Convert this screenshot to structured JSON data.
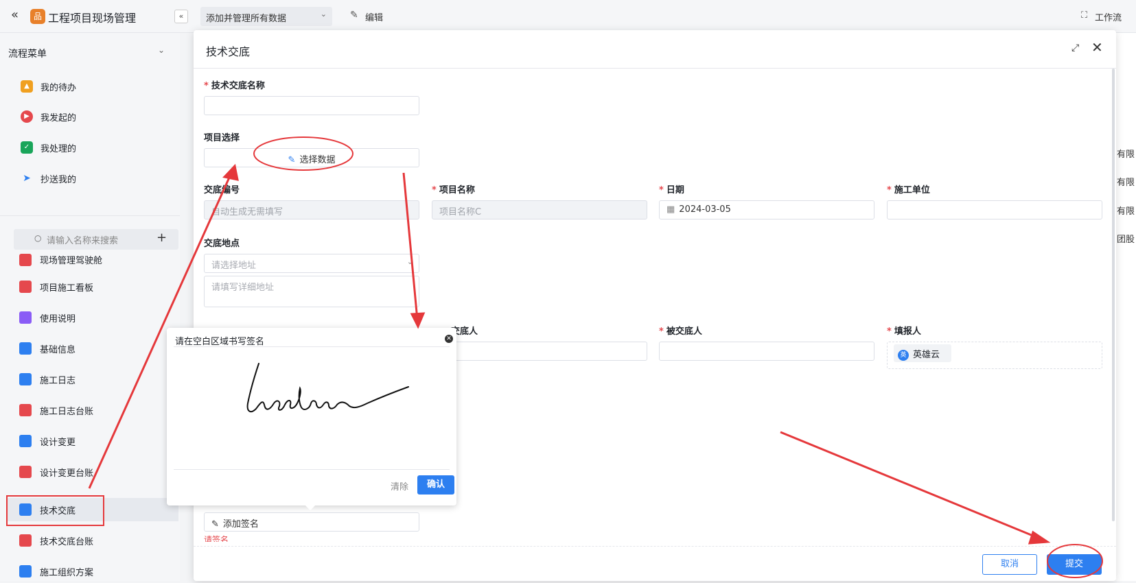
{
  "header": {
    "logo_char": "品",
    "app_title": "工程项目现场管理",
    "back_icon": "«",
    "collapse_icon": "«",
    "dataset_selector": "添加并管理所有数据",
    "edit_label": "编辑",
    "workflow_label": "工作流"
  },
  "sidebar": {
    "section_title": "流程菜单",
    "flow_items": [
      {
        "label": "我的待办",
        "icon": "bell-icon",
        "color": "#f0a020"
      },
      {
        "label": "我发起的",
        "icon": "play-icon",
        "color": "#e5484d"
      },
      {
        "label": "我处理的",
        "icon": "check-icon",
        "color": "#19a55a"
      },
      {
        "label": "抄送我的",
        "icon": "send-icon",
        "color": "#2d7ff0"
      }
    ],
    "search_placeholder": "请输入名称来搜索",
    "add_icon": "+",
    "nav_items": [
      {
        "label": "现场管理驾驶舱",
        "color": "#e5484d"
      },
      {
        "label": "项目施工看板",
        "color": "#e5484d"
      },
      {
        "label": "使用说明",
        "color": "#8a5cf6"
      },
      {
        "label": "基础信息",
        "color": "#2d7ff0"
      },
      {
        "label": "施工日志",
        "color": "#2d7ff0"
      },
      {
        "label": "施工日志台账",
        "color": "#e5484d"
      },
      {
        "label": "设计变更",
        "color": "#2d7ff0"
      },
      {
        "label": "设计变更台账",
        "color": "#e5484d"
      },
      {
        "label": "技术交底",
        "color": "#2d7ff0"
      },
      {
        "label": "技术交底台账",
        "color": "#e5484d"
      },
      {
        "label": "施工组织方案",
        "color": "#2d7ff0"
      }
    ]
  },
  "background_table": {
    "cells": [
      "有限",
      "有限",
      "有限",
      "团股"
    ]
  },
  "modal": {
    "title": "技术交底",
    "fields": {
      "name_label": "技术交底名称",
      "project_select_label": "项目选择",
      "select_data_button": "选择数据",
      "number_label": "交底编号",
      "number_placeholder": "自动生成无需填写",
      "project_name_label": "项目名称",
      "project_name_value": "项目名称C",
      "date_label": "日期",
      "date_value": "2024-03-05",
      "construction_unit_label": "施工单位",
      "location_label": "交底地点",
      "address_select_placeholder": "请选择地址",
      "address_detail_placeholder": "请填写详细地址",
      "discloser_label": "交底人",
      "disclosee_label": "被交底人",
      "filler_label": "填报人",
      "filler_value": "英雄云",
      "filler_avatar": "英",
      "add_signature_label": "添加签名",
      "signature_error": "请签名"
    },
    "cancel_label": "取消",
    "submit_label": "提交"
  },
  "signature_popover": {
    "title": "请在空白区域书写签名",
    "clear_label": "清除",
    "confirm_label": "确认"
  }
}
